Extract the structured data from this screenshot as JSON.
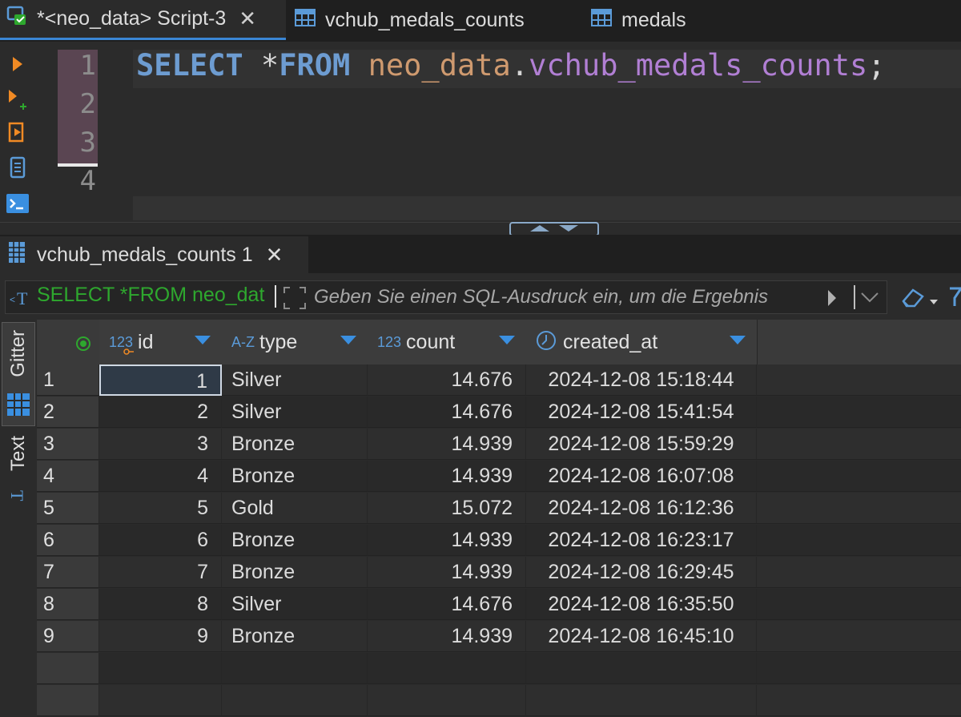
{
  "tabs": [
    {
      "label": "*<neo_data> Script-3",
      "close": "✕",
      "icon": "script-icon"
    },
    {
      "label": "vchub_medals_counts",
      "icon": "table-icon"
    },
    {
      "label": "medals",
      "icon": "table-icon"
    }
  ],
  "editor": {
    "line_numbers": [
      "1",
      "2",
      "3",
      "4"
    ],
    "code": {
      "kw1": "SELECT",
      "op": " *",
      "kw2": "FROM",
      "schema": " neo_data",
      "dot": ".",
      "table": "vchub_medals_counts",
      "end": ";"
    }
  },
  "result_tab": {
    "label": "vchub_medals_counts 1",
    "close": "✕"
  },
  "filter": {
    "sql": "SELECT *FROM neo_dat",
    "placeholder": "Geben Sie einen SQL-Ausdruck ein, um die Ergebnis"
  },
  "side_panel": {
    "grid_label": "Gitter",
    "text_label": "Text"
  },
  "columns": [
    {
      "name": "id",
      "type_badge": "123"
    },
    {
      "name": "type",
      "type_badge": "A-Z"
    },
    {
      "name": "count",
      "type_badge": "123"
    },
    {
      "name": "created_at",
      "type_badge": "clock"
    }
  ],
  "rows": [
    {
      "n": "1",
      "id": "1",
      "type": "Silver",
      "count": "14.676",
      "created_at": "2024-12-08 15:18:44"
    },
    {
      "n": "2",
      "id": "2",
      "type": "Silver",
      "count": "14.676",
      "created_at": "2024-12-08 15:41:54"
    },
    {
      "n": "3",
      "id": "3",
      "type": "Bronze",
      "count": "14.939",
      "created_at": "2024-12-08 15:59:29"
    },
    {
      "n": "4",
      "id": "4",
      "type": "Bronze",
      "count": "14.939",
      "created_at": "2024-12-08 16:07:08"
    },
    {
      "n": "5",
      "id": "5",
      "type": "Gold",
      "count": "15.072",
      "created_at": "2024-12-08 16:12:36"
    },
    {
      "n": "6",
      "id": "6",
      "type": "Bronze",
      "count": "14.939",
      "created_at": "2024-12-08 16:23:17"
    },
    {
      "n": "7",
      "id": "7",
      "type": "Bronze",
      "count": "14.939",
      "created_at": "2024-12-08 16:29:45"
    },
    {
      "n": "8",
      "id": "8",
      "type": "Silver",
      "count": "14.676",
      "created_at": "2024-12-08 16:35:50"
    },
    {
      "n": "9",
      "id": "9",
      "type": "Bronze",
      "count": "14.939",
      "created_at": "2024-12-08 16:45:10"
    }
  ],
  "colors": {
    "accent": "#3a86d4",
    "keyword": "#6d9cd1",
    "schema": "#cf9a6f",
    "table": "#b17fd4",
    "filter_sql": "#2ea82e"
  }
}
